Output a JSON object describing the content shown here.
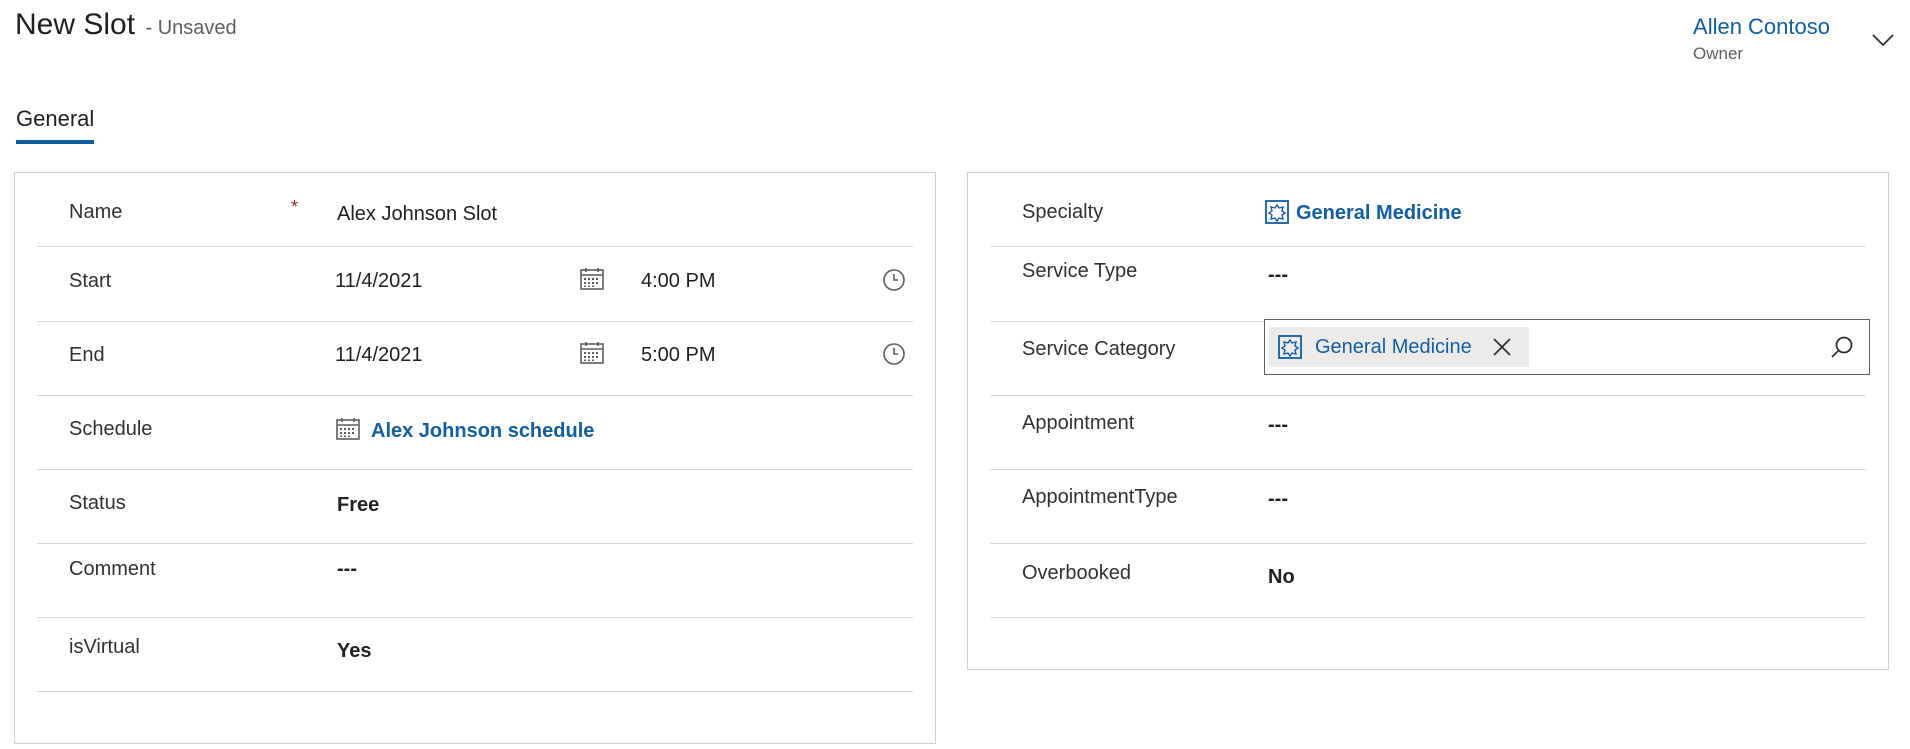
{
  "header": {
    "title": "New Slot",
    "status": "- Unsaved"
  },
  "owner": {
    "name": "Allen Contoso",
    "role": "Owner"
  },
  "tabs": [
    {
      "label": "General"
    }
  ],
  "left_fields": {
    "name": {
      "label": "Name",
      "required": "*",
      "value": "Alex Johnson Slot"
    },
    "start": {
      "label": "Start",
      "date": "11/4/2021",
      "time": "4:00 PM"
    },
    "end": {
      "label": "End",
      "date": "11/4/2021",
      "time": "5:00 PM"
    },
    "schedule": {
      "label": "Schedule",
      "value": "Alex Johnson schedule"
    },
    "status": {
      "label": "Status",
      "value": "Free"
    },
    "comment": {
      "label": "Comment",
      "value": "---"
    },
    "isvirtual": {
      "label": "isVirtual",
      "value": "Yes"
    }
  },
  "right_fields": {
    "specialty": {
      "label": "Specialty",
      "value": "General Medicine"
    },
    "service_type": {
      "label": "Service Type",
      "value": "---"
    },
    "service_category": {
      "label": "Service Category",
      "value": "General Medicine"
    },
    "appointment": {
      "label": "Appointment",
      "value": "---"
    },
    "appointment_type": {
      "label": "AppointmentType",
      "value": "---"
    },
    "overbooked": {
      "label": "Overbooked",
      "value": "No"
    }
  },
  "icons": {
    "calendar": "calendar-icon",
    "clock": "clock-icon",
    "entity": "entity-record-icon",
    "clear": "close-icon",
    "search": "search-icon",
    "chevron": "chevron-down-icon"
  },
  "colors": {
    "accent": "#115ea3",
    "required": "#a4262c",
    "border": "#d2d0ce"
  }
}
